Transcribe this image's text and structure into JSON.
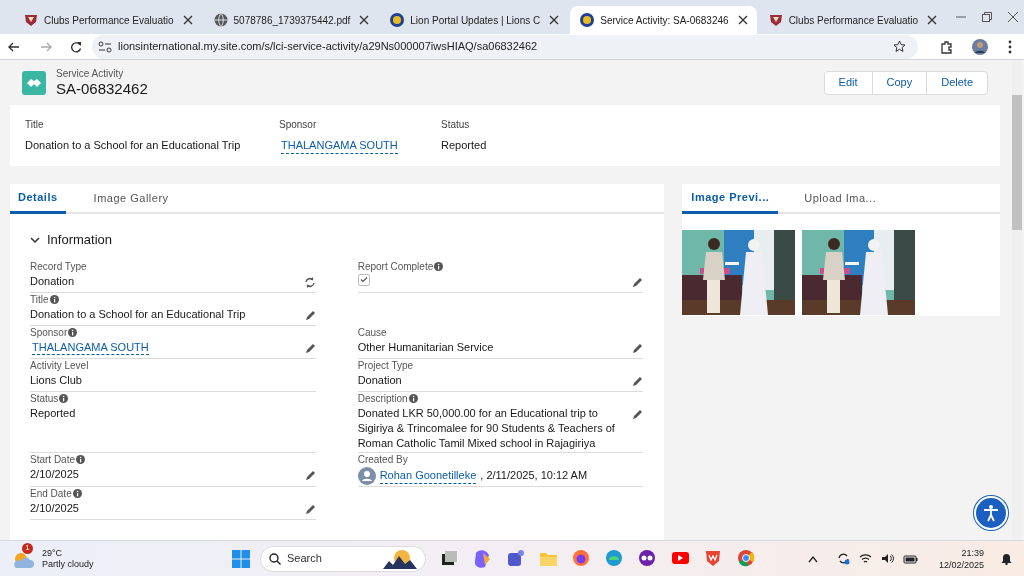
{
  "browser": {
    "tabs": [
      {
        "kind": "crest",
        "title": "Clubs Performance Evaluatio",
        "selected": false
      },
      {
        "kind": "globe",
        "title": "5078786_1739375442.pdf",
        "selected": false
      },
      {
        "kind": "lions",
        "title": "Lion Portal Updates | Lions C",
        "selected": false
      },
      {
        "kind": "lions",
        "title": "Service Activity: SA-0683246",
        "selected": true
      },
      {
        "kind": "crest",
        "title": "Clubs Performance Evaluatio",
        "selected": false
      }
    ],
    "url": "lionsinternational.my.site.com/s/lci-service-activity/a29Ns000007iwsHIAQ/sa06832462"
  },
  "record": {
    "object_label": "Service Activity",
    "name": "SA-06832462",
    "buttons": [
      "Edit",
      "Copy",
      "Delete"
    ]
  },
  "highlights": [
    {
      "label": "Title",
      "value": "Donation to a School for an Educational Trip",
      "kind": "text"
    },
    {
      "label": "Sponsor",
      "value": "THALANGAMA SOUTH",
      "kind": "link"
    },
    {
      "label": "Status",
      "value": "Reported",
      "kind": "text"
    }
  ],
  "detail_tabs": [
    {
      "label": "Details",
      "selected": true
    },
    {
      "label": "Image Gallery",
      "selected": false
    }
  ],
  "section": {
    "title": "Information",
    "expanded": true,
    "rows": [
      {
        "left": {
          "label": "Record Type",
          "info": false,
          "kind": "text",
          "value": "Donation",
          "action": {
            "kind": "change"
          }
        },
        "right": {
          "label": "Report Complete",
          "info": true,
          "kind": "checkbox",
          "checked": true,
          "action": {
            "kind": "edit"
          }
        }
      },
      {
        "left": {
          "label": "Title",
          "info": true,
          "kind": "text",
          "value": "Donation to a School for an Educational Trip",
          "action": {
            "kind": "edit"
          }
        }
      },
      {
        "left": {
          "label": "Sponsor",
          "info": true,
          "kind": "link",
          "value": "THALANGAMA SOUTH",
          "action": {
            "kind": "edit"
          }
        },
        "right": {
          "label": "Cause",
          "info": false,
          "kind": "text",
          "value": "Other Humanitarian Service",
          "action": {
            "kind": "edit"
          }
        }
      },
      {
        "left": {
          "label": "Activity Level",
          "info": false,
          "kind": "text",
          "value": "Lions Club"
        },
        "right": {
          "label": "Project Type",
          "info": false,
          "kind": "text",
          "value": "Donation",
          "action": {
            "kind": "edit"
          }
        }
      },
      {
        "left": {
          "label": "Status",
          "info": true,
          "kind": "text",
          "value": "Reported"
        },
        "right": {
          "label": "Description",
          "info": true,
          "kind": "text",
          "value": "Donated LKR 50,000.00 for an Educational trip to Sigiriya & Trincomalee for 90 Students & Teachers of Roman Catholic Tamil Mixed school in Rajagiriya",
          "action": {
            "kind": "edit"
          }
        }
      },
      {
        "left": {
          "label": "Start Date",
          "info": true,
          "kind": "text",
          "value": "2/10/2025",
          "action": {
            "kind": "edit"
          }
        },
        "right": {
          "label": "Created By",
          "info": false,
          "kind": "user",
          "user": "Rohan Goonetilleke",
          "value": ", 2/11/2025, 10:12 AM"
        }
      },
      {
        "left": {
          "label": "End Date",
          "info": true,
          "kind": "text",
          "value": "2/10/2025",
          "action": {
            "kind": "edit"
          }
        }
      }
    ]
  },
  "image_panel": {
    "tabs": [
      {
        "label": "Image Previ...",
        "selected": true
      },
      {
        "label": "Upload Ima...",
        "selected": false
      }
    ]
  },
  "taskbar": {
    "weather": {
      "temp": "29°C",
      "condition": "Partly cloudy",
      "badge": "1"
    },
    "search": {
      "placeholder": "Search"
    },
    "time": "21:39",
    "date": "12/02/2025"
  }
}
